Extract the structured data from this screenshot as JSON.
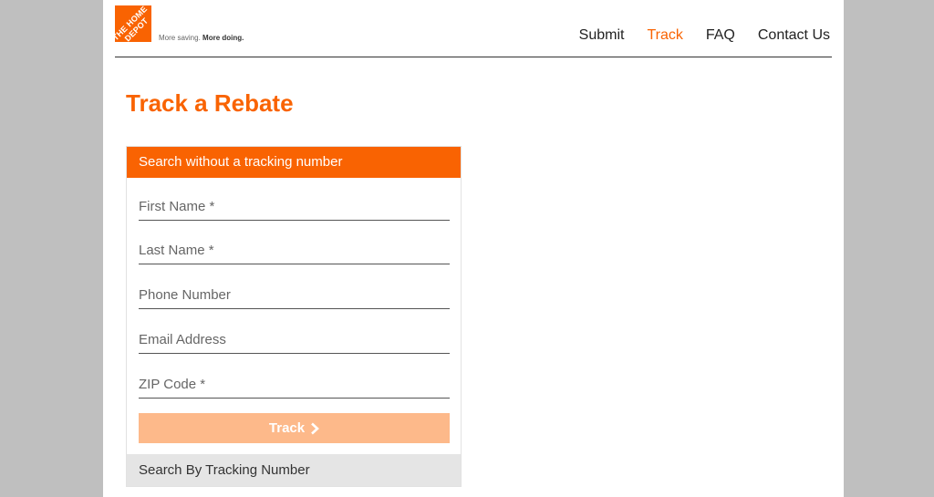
{
  "header": {
    "logo_text": "THE HOME DEPOT",
    "tagline_light": "More saving.",
    "tagline_bold": "More doing."
  },
  "nav": {
    "items": [
      {
        "label": "Submit",
        "active": false
      },
      {
        "label": "Track",
        "active": true
      },
      {
        "label": "FAQ",
        "active": false
      },
      {
        "label": "Contact Us",
        "active": false
      }
    ]
  },
  "main": {
    "title": "Track a Rebate"
  },
  "search_panel": {
    "header": "Search without a tracking number",
    "fields": {
      "first_name": {
        "placeholder": "First Name *",
        "value": ""
      },
      "last_name": {
        "placeholder": "Last Name *",
        "value": ""
      },
      "phone": {
        "placeholder": "Phone Number",
        "value": ""
      },
      "email": {
        "placeholder": "Email Address",
        "value": ""
      },
      "zip": {
        "placeholder": "ZIP Code *",
        "value": ""
      }
    },
    "track_button": "Track",
    "tracking_tab": "Search By Tracking Number"
  },
  "colors": {
    "brand_orange": "#f96302",
    "button_disabled": "#fdb98a",
    "tab_gray": "#e5e5e5",
    "backdrop_gray": "#bfbfbf"
  },
  "icons": {
    "track_button_icon": "chevron-right-icon"
  }
}
